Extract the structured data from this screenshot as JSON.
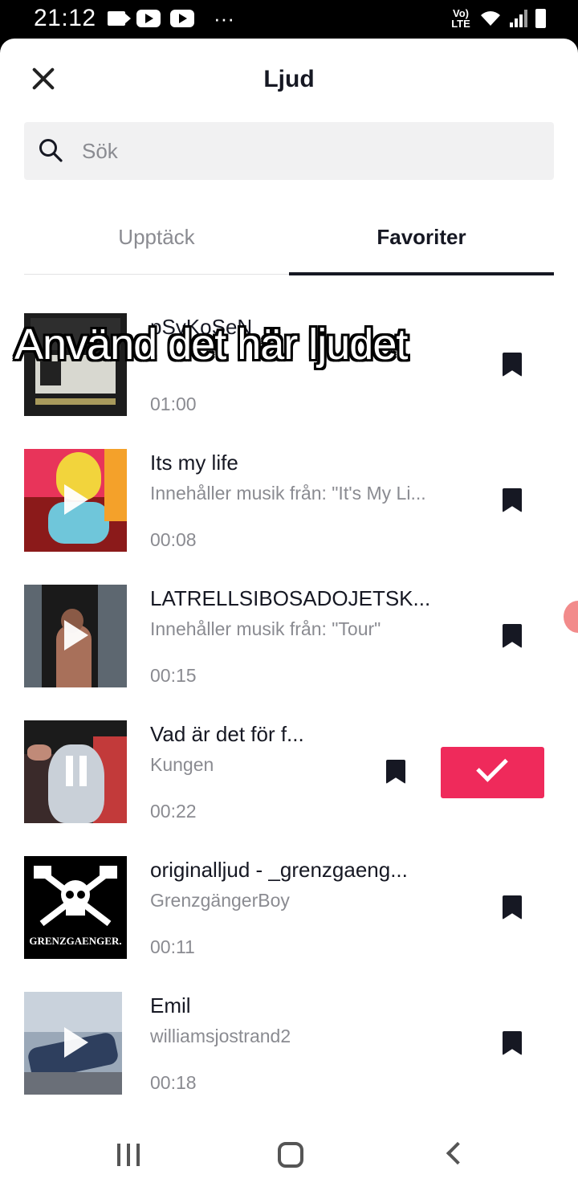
{
  "status_bar": {
    "time": "21:12",
    "network": "Vo) LTE",
    "dots": "···"
  },
  "header": {
    "title": "Ljud"
  },
  "search": {
    "placeholder": "Sök",
    "value": ""
  },
  "tabs": [
    {
      "label": "Upptäck"
    },
    {
      "label": "Favoriter"
    }
  ],
  "overlay_caption": "Använd det här ljudet",
  "sounds": [
    {
      "title": "pSyKoSeN",
      "subtitle": "",
      "duration": "01:00",
      "thumb_theme": "dark-album",
      "state": "idle"
    },
    {
      "title": "Its my life",
      "subtitle": "Innehåller musik från: \"It's My Li...",
      "duration": "00:08",
      "thumb_theme": "cartoon",
      "state": "idle"
    },
    {
      "title": "LATRELLSIBOSADOJETSK...",
      "subtitle": "Innehåller musik från: \"Tour\"",
      "duration": "00:15",
      "thumb_theme": "photo-dark",
      "state": "idle"
    },
    {
      "title": "Vad är det för f...",
      "subtitle": "Kungen",
      "duration": "00:22",
      "thumb_theme": "photo-face",
      "state": "playing"
    },
    {
      "title": "originalljud - _grenzgaeng...",
      "subtitle": "GrenzgängerBoy",
      "duration": "00:11",
      "thumb_theme": "logo-black",
      "state": "idle"
    },
    {
      "title": "Emil",
      "subtitle": "williamsjostrand2",
      "duration": "00:18",
      "thumb_theme": "photo-car",
      "state": "idle"
    }
  ],
  "thumb_logo_text": "GRENZGAENGER.",
  "colors": {
    "accent": "#ef2a5b",
    "text": "#161823",
    "muted": "#8a8b91"
  },
  "icons": {
    "close": "close-icon",
    "search": "search-icon",
    "bookmark": "bookmark-icon",
    "play": "play-icon",
    "pause": "pause-icon",
    "check": "check-icon"
  }
}
